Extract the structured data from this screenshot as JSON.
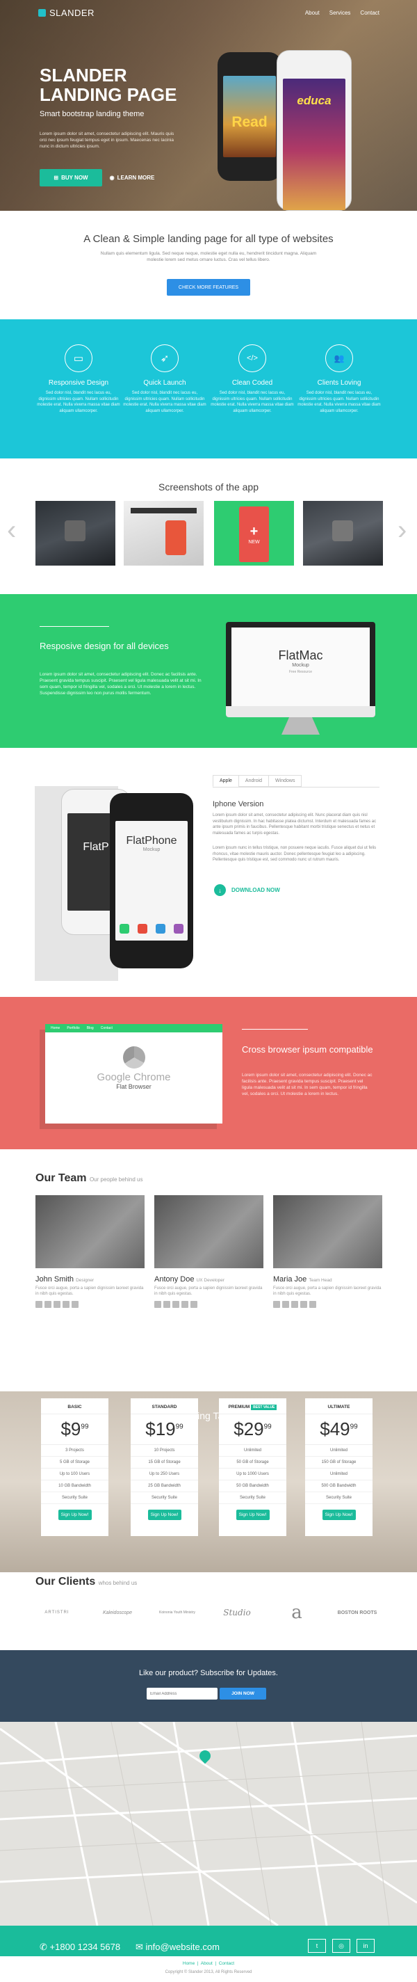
{
  "header": {
    "logo": "SLANDER",
    "nav": [
      "About",
      "Services",
      "Contact"
    ]
  },
  "hero": {
    "title": "SLANDER LANDING PAGE",
    "subtitle": "Smart bootstrap landing theme",
    "text": "Lorem ipsum dolor sit amet, consectetur adipiscing elit. Mauris quis orci nec ipsum feugiat tempus eget in ipsum. Maecenas nec lacinia nunc in dictum ultricies ipsum.",
    "buy_label": "BUY NOW",
    "learn_label": "LEARN MORE",
    "phone_left_text": "Read",
    "phone_right_text": "educa"
  },
  "intro": {
    "title": "A Clean & Simple landing page for all type of websites",
    "text": "Nullam quis elementum ligula. Sed neque neque, molestie eget nulla eu, hendrerit tincidunt magna. Aliquam molestie lorem sed metus ornare luctus. Cras vel tellus libero.",
    "button": "CHECK MORE FEATURES"
  },
  "features": [
    {
      "icon": "monitor-icon",
      "glyph": "▭",
      "title": "Responsive Design",
      "text": "Sed dolor nisl, blandit nec lacus eu, dignissim ultricies quam. Nullam sollicitudin molestie erat. Nulla viverra massa vitae diam aliquam ullamcorper."
    },
    {
      "icon": "rocket-icon",
      "glyph": "➶",
      "title": "Quick Launch",
      "text": "Sed dolor nisl, blandit nec lacus eu, dignissim ultricies quam. Nullam sollicitudin molestie erat. Nulla viverra massa vitae diam aliquam ullamcorper."
    },
    {
      "icon": "code-icon",
      "glyph": "</>",
      "title": "Clean Coded",
      "text": "Sed dolor nisl, blandit nec lacus eu, dignissim ultricies quam. Nullam sollicitudin molestie erat. Nulla viverra massa vitae diam aliquam ullamcorper."
    },
    {
      "icon": "users-icon",
      "glyph": "👥",
      "title": "Clients Loving",
      "text": "Sed dolor nisl, blandit nec lacus eu, dignissim ultricies quam. Nullam sollicitudin molestie erat. Nulla viverra massa vitae diam aliquam ullamcorper."
    }
  ],
  "screenshots": {
    "title": "Screenshots of the app",
    "new_label": "NEW"
  },
  "responsive": {
    "title": "Resposive design for all devices",
    "text": "Lorem ipsum dolor sit amet, consectetur adipiscing elit. Donec ac facilisis ante. Praesent gravida tempus suscipit. Praesent vel ligula malesuada velit at sit mi. In sem quam, tempor id fringilla vel, sodales a orci. Ut molestie a lorem in lectus. Suspendisse dignissim leo non purus mollis fermentum.",
    "mac_title": "FlatMac",
    "mac_sub": "Mockup",
    "mac_tag": "Free Resource"
  },
  "iphone_section": {
    "tabs": [
      "Apple",
      "Android",
      "Windows"
    ],
    "title": "Iphone Version",
    "text1": "Lorem ipsum dolor sit amet, consectetur adipiscing elit. Nunc placerat diam quis nisl vestibulum dignissim. In hac habitasse platea dictumst. Interdum et malesuada fames ac ante ipsum primis in faucibus. Pellentesque habitant morbi tristique senectus et netus et malesuada fames ac turpis egestas.",
    "text2": "Lorem ipsum nunc in tellus tristique, non posuere neque iaculis. Fusce aliquet dui ut felis rhoncus, vitae molestie mauris auctor. Donec pellentesque feugiat leo a adipiscing. Pellentesque quis tristique est, sed commodo nunc ut rutrum mauris.",
    "download": "DOWNLOAD NOW",
    "phone_title": "FlatPhone",
    "phone_sub": "Mockup",
    "phone_left_title": "FlatP"
  },
  "browser_section": {
    "title": "Cross browser ipsum compatible",
    "text": "Lorem ipsum dolor sit amet, consectetur adipiscing elit. Donec ac facilisis ante. Praesent gravida tempus suscipit. Praesent vel ligula malesuada velit at sit mi. In sem quam, tempor id fringilla vel, sodales a orci. Ut molestie a lorem in lectus.",
    "chrome_title": "Google Chrome",
    "chrome_sub": "Flat Browser",
    "browser_nav": [
      "Home",
      "Portfolio",
      "Blog",
      "Contact"
    ]
  },
  "team": {
    "title": "Our Team",
    "subtitle": "Our people behind us",
    "members": [
      {
        "name": "John Smith",
        "role": "Designer",
        "text": "Fusce orci augue, porta a sapien dignissim laoreet gravida in nibh quis egestas."
      },
      {
        "name": "Antony Doe",
        "role": "UX Developer",
        "text": "Fusce orci augue, porta a sapien dignissim laoreet gravida in nibh quis egestas."
      },
      {
        "name": "Maria Joe",
        "role": "Team Head",
        "text": "Fusce orci augue, porta a sapien dignissim laoreet gravida in nibh quis egestas."
      }
    ]
  },
  "pricing": {
    "title": "Pricing Table",
    "plans": [
      {
        "name": "BASIC",
        "badge": "",
        "dollars": "$9",
        "cents": "99",
        "rows": [
          "3 Projects",
          "5 GB of Storage",
          "Up to 100 Users",
          "10 GB Bandwidth",
          "Security Suite"
        ],
        "button": "Sign Up Now!"
      },
      {
        "name": "STANDARD",
        "badge": "",
        "dollars": "$19",
        "cents": "99",
        "rows": [
          "10 Projects",
          "15 GB of Storage",
          "Up to 250 Users",
          "25 GB Bandwidth",
          "Security Suite"
        ],
        "button": "Sign Up Now!"
      },
      {
        "name": "PREMIUM",
        "badge": "BEST VALUE",
        "dollars": "$29",
        "cents": "99",
        "rows": [
          "Unlimited",
          "50 GB of Storage",
          "Up to 1000 Users",
          "50 GB Bandwidth",
          "Security Suite"
        ],
        "button": "Sign Up Now!"
      },
      {
        "name": "ULTIMATE",
        "badge": "",
        "dollars": "$49",
        "cents": "99",
        "rows": [
          "Unlimited",
          "150 GB of Storage",
          "Unlimited",
          "500 GB Bandwidth",
          "Security Suite"
        ],
        "button": "Sign Up Now!"
      }
    ]
  },
  "clients": {
    "title": "Our Clients",
    "subtitle": "whos behind us",
    "logos": [
      "ARTISTRI",
      "Kaleidoscope",
      "Koinonia Youth Ministry",
      "Studio",
      "a",
      "BOSTON ROOTS"
    ]
  },
  "subscribe": {
    "title": "Like our product? Subscribe for Updates.",
    "placeholder": "Email Address",
    "button": "JOIN NOW"
  },
  "contact": {
    "phone": "+1800 1234 5678",
    "email": "info@website.com",
    "social": [
      "twitter-icon",
      "instagram-icon",
      "linkedin-icon"
    ]
  },
  "footer": {
    "links": [
      "Home",
      "About",
      "Contact"
    ],
    "copyright": "Copyright © Slander 2013, All Rights Reserved"
  },
  "colors": {
    "teal": "#1bbc9b",
    "cyan": "#1cc6d8",
    "green": "#2ecc71",
    "red": "#ea6b66",
    "navy": "#34495e"
  }
}
